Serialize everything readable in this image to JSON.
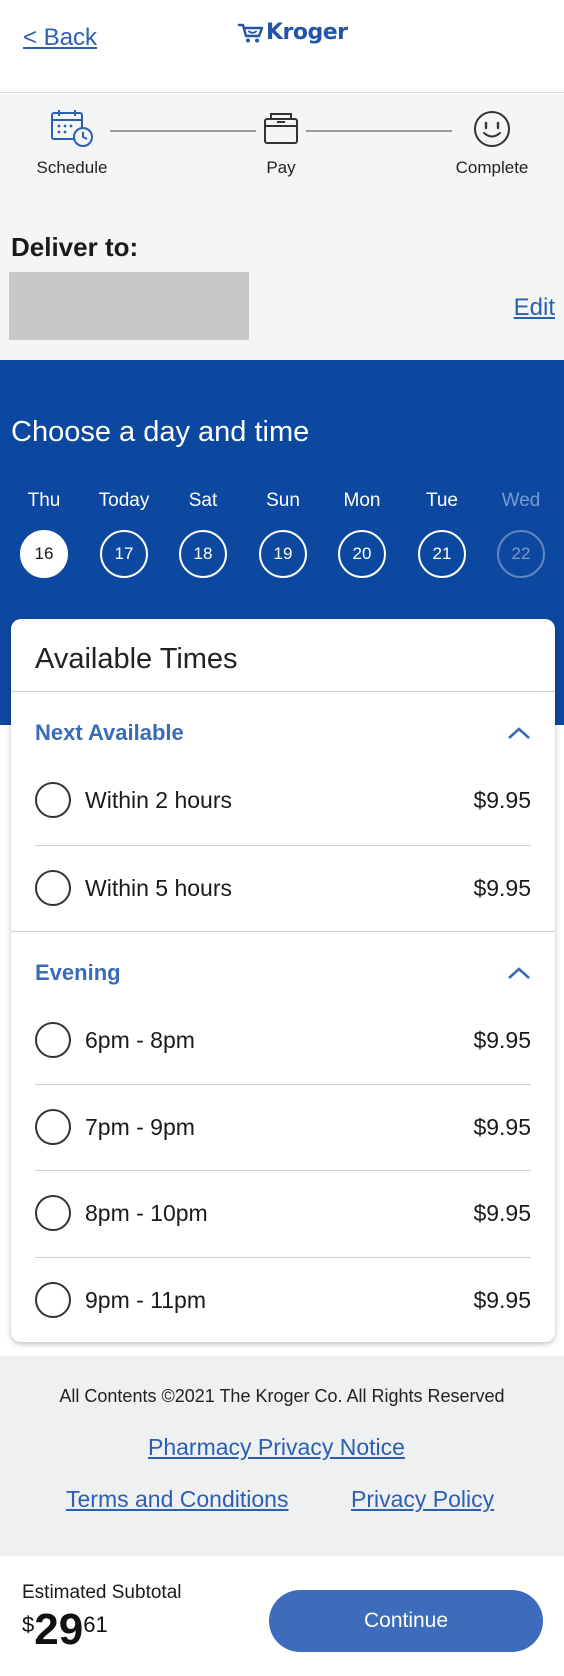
{
  "header": {
    "back_label": "< Back",
    "logo_text": "Kroger",
    "brand_color": "#2155a6"
  },
  "progress": {
    "steps": [
      {
        "label": "Schedule",
        "icon": "calendar-clock-icon"
      },
      {
        "label": "Pay",
        "icon": "wallet-icon"
      },
      {
        "label": "Complete",
        "icon": "smiley-icon"
      }
    ],
    "current_step": "Schedule"
  },
  "delivery": {
    "title": "Deliver to:",
    "edit_label": "Edit"
  },
  "scheduler": {
    "title": "Choose a day and time",
    "background_color": "#0c48a0",
    "days": [
      {
        "name": "Thu",
        "date": "16",
        "state": "selected"
      },
      {
        "name": "Today",
        "date": "17",
        "state": "available"
      },
      {
        "name": "Sat",
        "date": "18",
        "state": "available"
      },
      {
        "name": "Sun",
        "date": "19",
        "state": "available"
      },
      {
        "name": "Mon",
        "date": "20",
        "state": "available"
      },
      {
        "name": "Tue",
        "date": "21",
        "state": "available"
      },
      {
        "name": "Wed",
        "date": "22",
        "state": "disabled"
      }
    ]
  },
  "times": {
    "title": "Available Times",
    "groups": [
      {
        "title": "Next Available",
        "expanded": true,
        "slots": [
          {
            "label": "Within 2 hours",
            "price": "$9.95"
          },
          {
            "label": "Within 5 hours",
            "price": "$9.95"
          }
        ]
      },
      {
        "title": "Evening",
        "expanded": true,
        "slots": [
          {
            "label": "6pm - 8pm",
            "price": "$9.95"
          },
          {
            "label": "7pm - 9pm",
            "price": "$9.95"
          },
          {
            "label": "8pm - 10pm",
            "price": "$9.95"
          },
          {
            "label": "9pm - 11pm",
            "price": "$9.95"
          }
        ]
      }
    ]
  },
  "footer": {
    "copyright": "All Contents ©2021 The Kroger Co. All Rights Reserved",
    "pharmacy_privacy": "Pharmacy Privacy Notice",
    "terms": "Terms and Conditions",
    "privacy_policy": "Privacy Policy"
  },
  "checkout": {
    "subtotal_label": "Estimated Subtotal",
    "currency": "$",
    "whole": "29",
    "cents": "61",
    "continue_label": "Continue",
    "button_color": "#3e6cbc"
  }
}
